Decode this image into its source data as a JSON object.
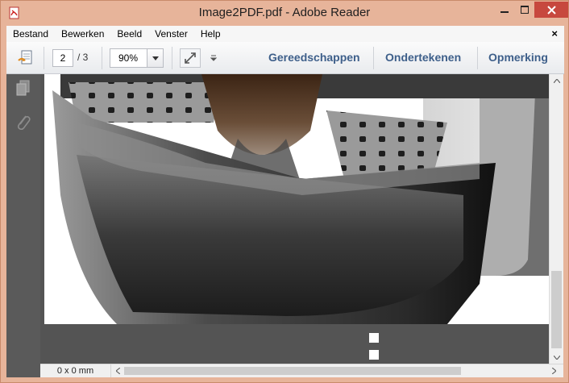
{
  "window": {
    "title": "Image2PDF.pdf - Adobe Reader"
  },
  "menu": {
    "items": [
      "Bestand",
      "Bewerken",
      "Beeld",
      "Venster",
      "Help"
    ],
    "close_glyph": "×"
  },
  "toolbar": {
    "page_current": "2",
    "page_total": "/ 3",
    "zoom": "90%",
    "links": [
      "Gereedschappen",
      "Ondertekenen",
      "Opmerking"
    ]
  },
  "leftrail": {
    "icons": [
      "pages-icon",
      "attachment-icon"
    ]
  },
  "status": {
    "dimensions": "0 x 0 mm"
  },
  "colors": {
    "title_bar": "#e7b49a",
    "close_button": "#c7483e",
    "link_text": "#3e5f8a",
    "doc_background": "#545454"
  }
}
